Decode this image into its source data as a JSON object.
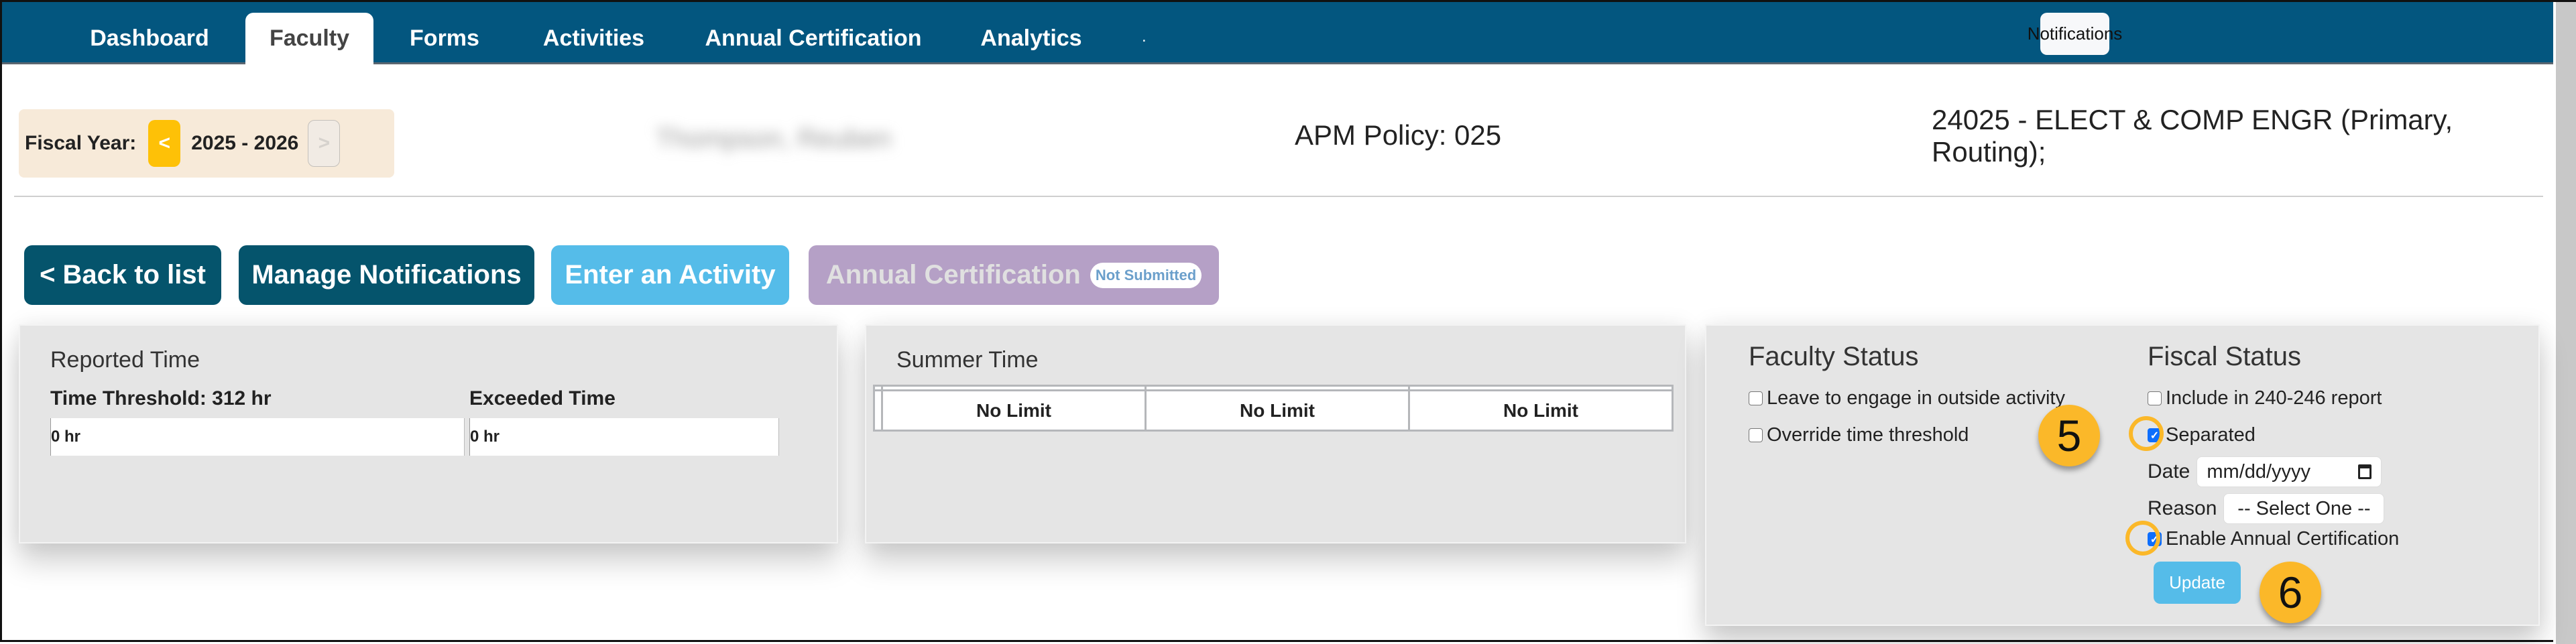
{
  "nav": {
    "tabs": [
      {
        "label": "Dashboard",
        "active": false
      },
      {
        "label": "Faculty",
        "active": true
      },
      {
        "label": "Forms",
        "active": false
      },
      {
        "label": "Activities",
        "active": false
      },
      {
        "label": "Annual Certification",
        "active": false
      },
      {
        "label": "Analytics",
        "active": false
      }
    ],
    "trailing_mark": ".",
    "notifications_label": "Notifications"
  },
  "header": {
    "fiscal_year_label": "Fiscal Year:",
    "prev_label": "<",
    "fiscal_year_value": "2025 - 2026",
    "next_label": ">",
    "faculty_name_blurred": "Thompson, Reuben",
    "apm_policy": "APM Policy: 025",
    "department": "24025 - ELECT & COMP ENGR (Primary, Routing);"
  },
  "actions": {
    "back_label": "< Back to list",
    "manage_label": "Manage Notifications",
    "enter_label": "Enter an Activity",
    "annual_label": "Annual Certification",
    "annual_badge": "Not Submitted"
  },
  "reported_time": {
    "title": "Reported Time",
    "threshold_label": "Time Threshold: 312 hr",
    "threshold_value": "0 hr",
    "exceeded_label": "Exceeded Time",
    "exceeded_value": "0 hr"
  },
  "summer_time": {
    "title": "Summer Time",
    "headers": [
      "",
      "",
      "",
      ""
    ],
    "cells": [
      "No Limit",
      "No Limit",
      "No Limit"
    ]
  },
  "faculty_status": {
    "title": "Faculty Status",
    "options": [
      {
        "label": "Leave to engage in outside activity",
        "checked": false
      },
      {
        "label": "Override time threshold",
        "checked": false
      }
    ]
  },
  "fiscal_status": {
    "title": "Fiscal Status",
    "include_label": "Include in 240-246 report",
    "include_checked": false,
    "separated_label": "Separated",
    "separated_checked": true,
    "date_label": "Date",
    "date_placeholder": "mm/dd/yyyy",
    "reason_label": "Reason",
    "reason_value": "-- Select One --",
    "enable_label": "Enable Annual Certification",
    "enable_checked": true,
    "update_label": "Update"
  },
  "annotations": {
    "step_5": "5",
    "step_6": "6",
    "accent": "#fbb829"
  },
  "colors": {
    "nav_bg": "#03567f",
    "primary_btn": "#05546c",
    "info_btn": "#55bce9",
    "annual_btn": "#b5a0c6",
    "fiscal_year_bg": "#f7ead9",
    "prev_btn": "#fec107",
    "panel_bg": "#e5e5e5",
    "checkbox_checked": "#0d6efd"
  }
}
